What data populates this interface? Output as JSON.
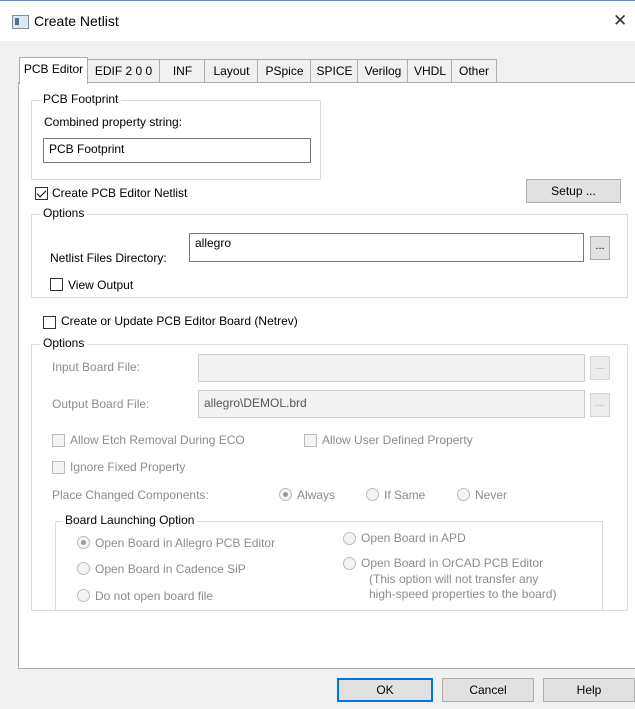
{
  "window": {
    "title": "Create Netlist",
    "close_symbol": "✕"
  },
  "tabs": [
    "PCB Editor",
    "EDIF 2 0 0",
    "INF",
    "Layout",
    "PSpice",
    "SPICE",
    "Verilog",
    "VHDL",
    "Other"
  ],
  "footprint": {
    "group_label": "PCB Footprint",
    "prop_label": "Combined property string:",
    "prop_value": "PCB Footprint"
  },
  "create_netlist": {
    "label": "Create PCB Editor Netlist",
    "checked": true
  },
  "setup_button": "Setup ...",
  "options1": {
    "group_label": "Options",
    "dir_label": "Netlist Files Directory:",
    "dir_value": "allegro",
    "browse": "...",
    "view_output": "View Output"
  },
  "netrev": {
    "label": "Create or Update PCB Editor Board (Netrev)",
    "checked": false
  },
  "options2": {
    "group_label": "Options",
    "input_label": "Input Board File:",
    "input_value": "",
    "output_label": "Output Board File:",
    "output_value": "allegro\\DEMOL.brd",
    "browse": "...",
    "allow_etch": "Allow Etch Removal During ECO",
    "allow_user": "Allow User Defined Property",
    "ignore_fixed": "Ignore Fixed Property",
    "place_label": "Place Changed Components:",
    "place_options": [
      "Always",
      "If Same",
      "Never"
    ],
    "place_selected": "Always"
  },
  "launch": {
    "group_label": "Board Launching Option",
    "opt_allegro": "Open Board in Allegro PCB Editor",
    "opt_sip": "Open Board in Cadence SiP",
    "opt_none": "Do not open board file",
    "opt_apd": "Open Board in APD",
    "opt_orcad": "Open Board in OrCAD PCB Editor",
    "note1": "(This option will not transfer any",
    "note2": "high-speed properties to the board)",
    "selected": "Open Board in Allegro PCB Editor"
  },
  "buttons": {
    "ok": "OK",
    "cancel": "Cancel",
    "help": "Help"
  }
}
